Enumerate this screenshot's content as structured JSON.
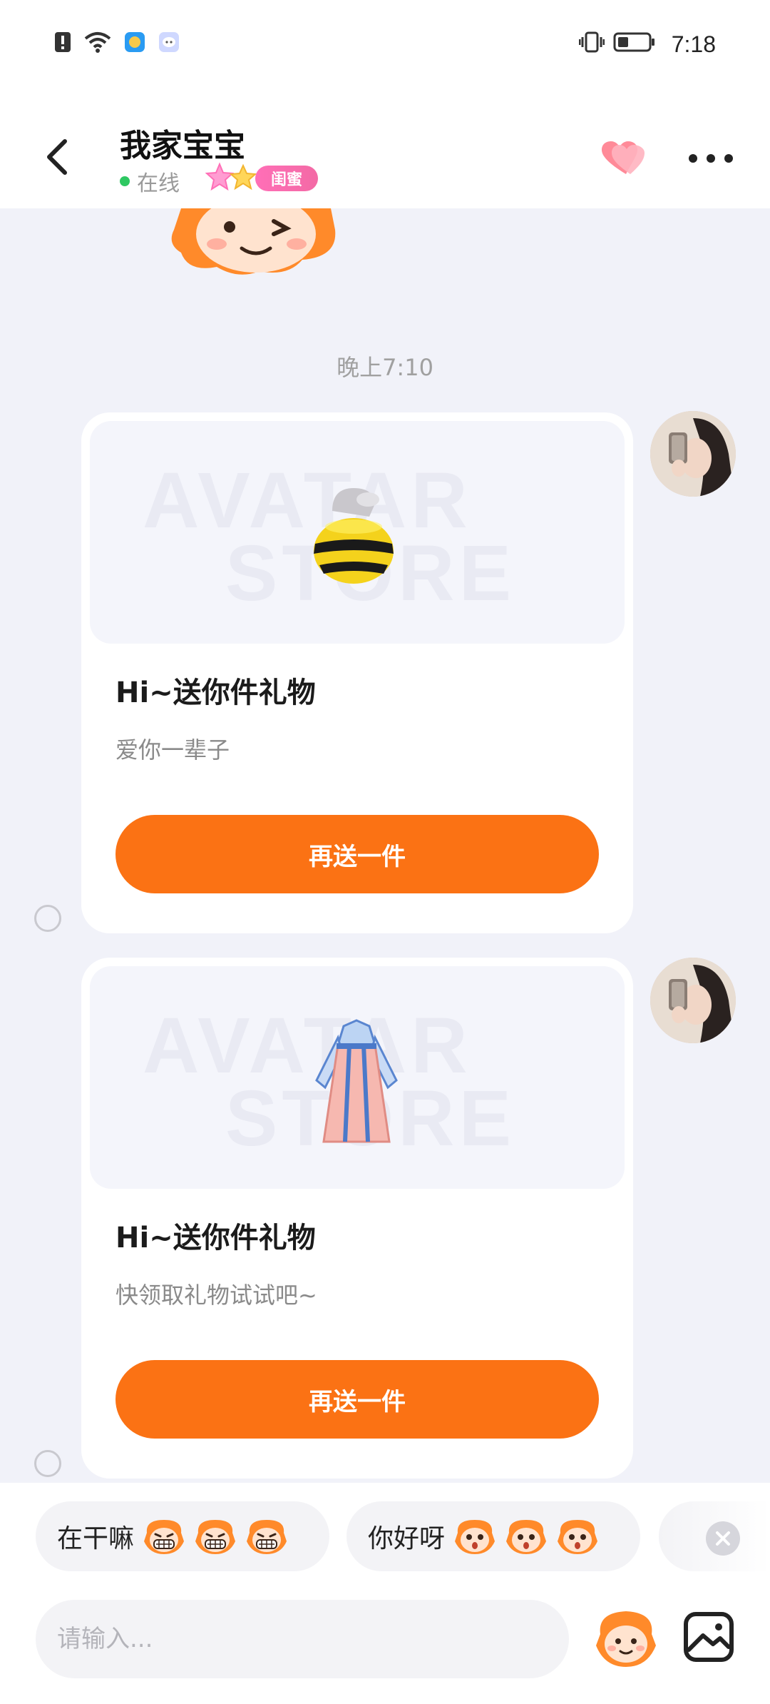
{
  "status_bar": {
    "time": "7:18"
  },
  "header": {
    "title": "我家宝宝",
    "online_status": "在线",
    "relationship_badge": "闺蜜"
  },
  "chat": {
    "time_divider": "晚上7:10",
    "messages": [
      {
        "watermark_line1": "AVATAR",
        "watermark_line2": "STORE",
        "title": "Hi~送你件礼物",
        "subtitle": "爱你一辈子",
        "button_label": "再送一件"
      },
      {
        "watermark_line1": "AVATAR",
        "watermark_line2": "STORE",
        "title": "Hi~送你件礼物",
        "subtitle": "快领取礼物试试吧~",
        "button_label": "再送一件"
      }
    ]
  },
  "quick_replies": [
    {
      "label": "在干嘛"
    },
    {
      "label": "你好呀"
    }
  ],
  "composer": {
    "placeholder": "请输入..."
  },
  "colors": {
    "accent_orange": "#fb7214",
    "online_green": "#2ec862",
    "badge_pink": "#f36aa5",
    "background": "#f1f2f9"
  }
}
